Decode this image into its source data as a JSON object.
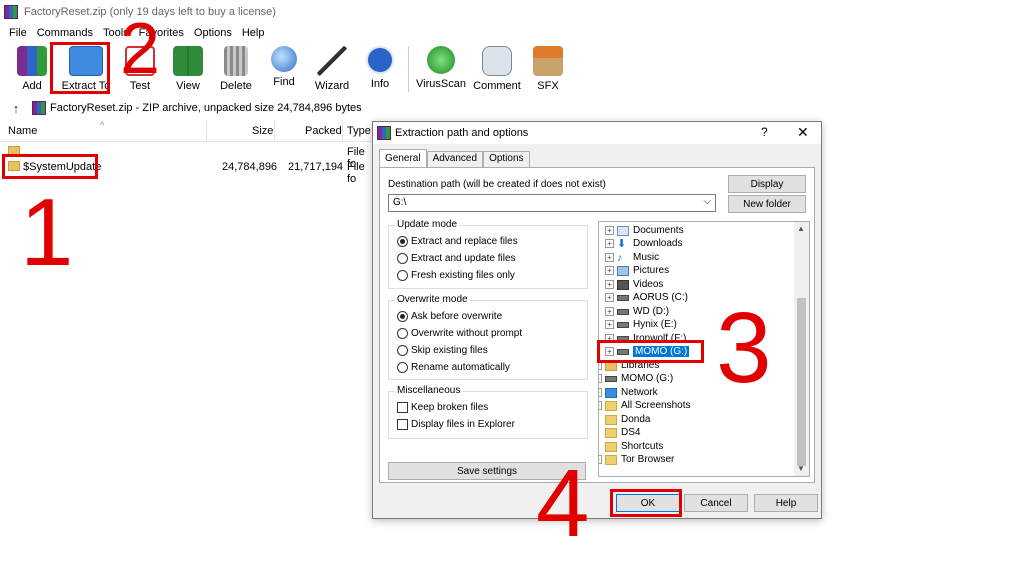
{
  "window": {
    "title": "FactoryReset.zip (only 19 days left to buy a license)"
  },
  "menu": [
    "File",
    "Commands",
    "Tools",
    "Favorites",
    "Options",
    "Help"
  ],
  "toolbar": {
    "add": "Add",
    "extract_to": "Extract To",
    "test": "Test",
    "view": "View",
    "delete": "Delete",
    "find": "Find",
    "wizard": "Wizard",
    "info": "Info",
    "virusscan": "VirusScan",
    "comment": "Comment",
    "sfx": "SFX"
  },
  "address": {
    "text": "FactoryReset.zip - ZIP archive, unpacked size 24,784,896 bytes"
  },
  "filelist": {
    "columns": {
      "name": "Name",
      "size": "Size",
      "packed": "Packed",
      "type": "Type"
    },
    "rows": [
      {
        "name": "..",
        "size": "",
        "packed": "",
        "type": "File fo"
      },
      {
        "name": "$SystemUpdate",
        "size": "24,784,896",
        "packed": "21,717,194",
        "type": "File fo"
      }
    ]
  },
  "steps": {
    "one": "1",
    "two": "2",
    "three": "3",
    "four": "4"
  },
  "dialog": {
    "title": "Extraction path and options",
    "help_glyph": "?",
    "close_glyph": "✕",
    "tabs": [
      "General",
      "Advanced",
      "Options"
    ],
    "dest_label": "Destination path (will be created if does not exist)",
    "dest_value": "G:\\",
    "display_button": "Display",
    "new_folder_button": "New folder",
    "update_mode": {
      "title": "Update mode",
      "options": [
        "Extract and replace files",
        "Extract and update files",
        "Fresh existing files only"
      ],
      "selected": 0
    },
    "overwrite_mode": {
      "title": "Overwrite mode",
      "options": [
        "Ask before overwrite",
        "Overwrite without prompt",
        "Skip existing files",
        "Rename automatically"
      ],
      "selected": 0
    },
    "misc": {
      "title": "Miscellaneous",
      "options": [
        "Keep broken files",
        "Display files in Explorer"
      ]
    },
    "save_settings": "Save settings",
    "tree": [
      {
        "label": "Documents",
        "icon": "documents-icon"
      },
      {
        "label": "Downloads",
        "icon": "downloads-icon"
      },
      {
        "label": "Music",
        "icon": "music-icon"
      },
      {
        "label": "Pictures",
        "icon": "pictures-icon"
      },
      {
        "label": "Videos",
        "icon": "videos-icon"
      },
      {
        "label": "AORUS (C:)",
        "icon": "drive-icon"
      },
      {
        "label": "WD (D:)",
        "icon": "drive-icon"
      },
      {
        "label": "Hynix (E:)",
        "icon": "drive-icon"
      },
      {
        "label": "Ironwolf (F:)",
        "icon": "drive-icon"
      },
      {
        "label": "MOMO (G:)",
        "icon": "drive-icon",
        "selected": true
      },
      {
        "label": "Libraries",
        "icon": "libraries-icon"
      },
      {
        "label": "MOMO (G:)",
        "icon": "drive-icon"
      },
      {
        "label": "Network",
        "icon": "network-icon"
      },
      {
        "label": "All Screenshots",
        "icon": "folder-icon"
      },
      {
        "label": "Donda",
        "icon": "folder-icon"
      },
      {
        "label": "DS4",
        "icon": "folder-icon"
      },
      {
        "label": "Shortcuts",
        "icon": "folder-icon"
      },
      {
        "label": "Tor Browser",
        "icon": "folder-icon"
      }
    ],
    "ok": "OK",
    "cancel": "Cancel",
    "help": "Help"
  },
  "colors": {
    "highlight": "#e00000",
    "selection": "#0078d7"
  }
}
